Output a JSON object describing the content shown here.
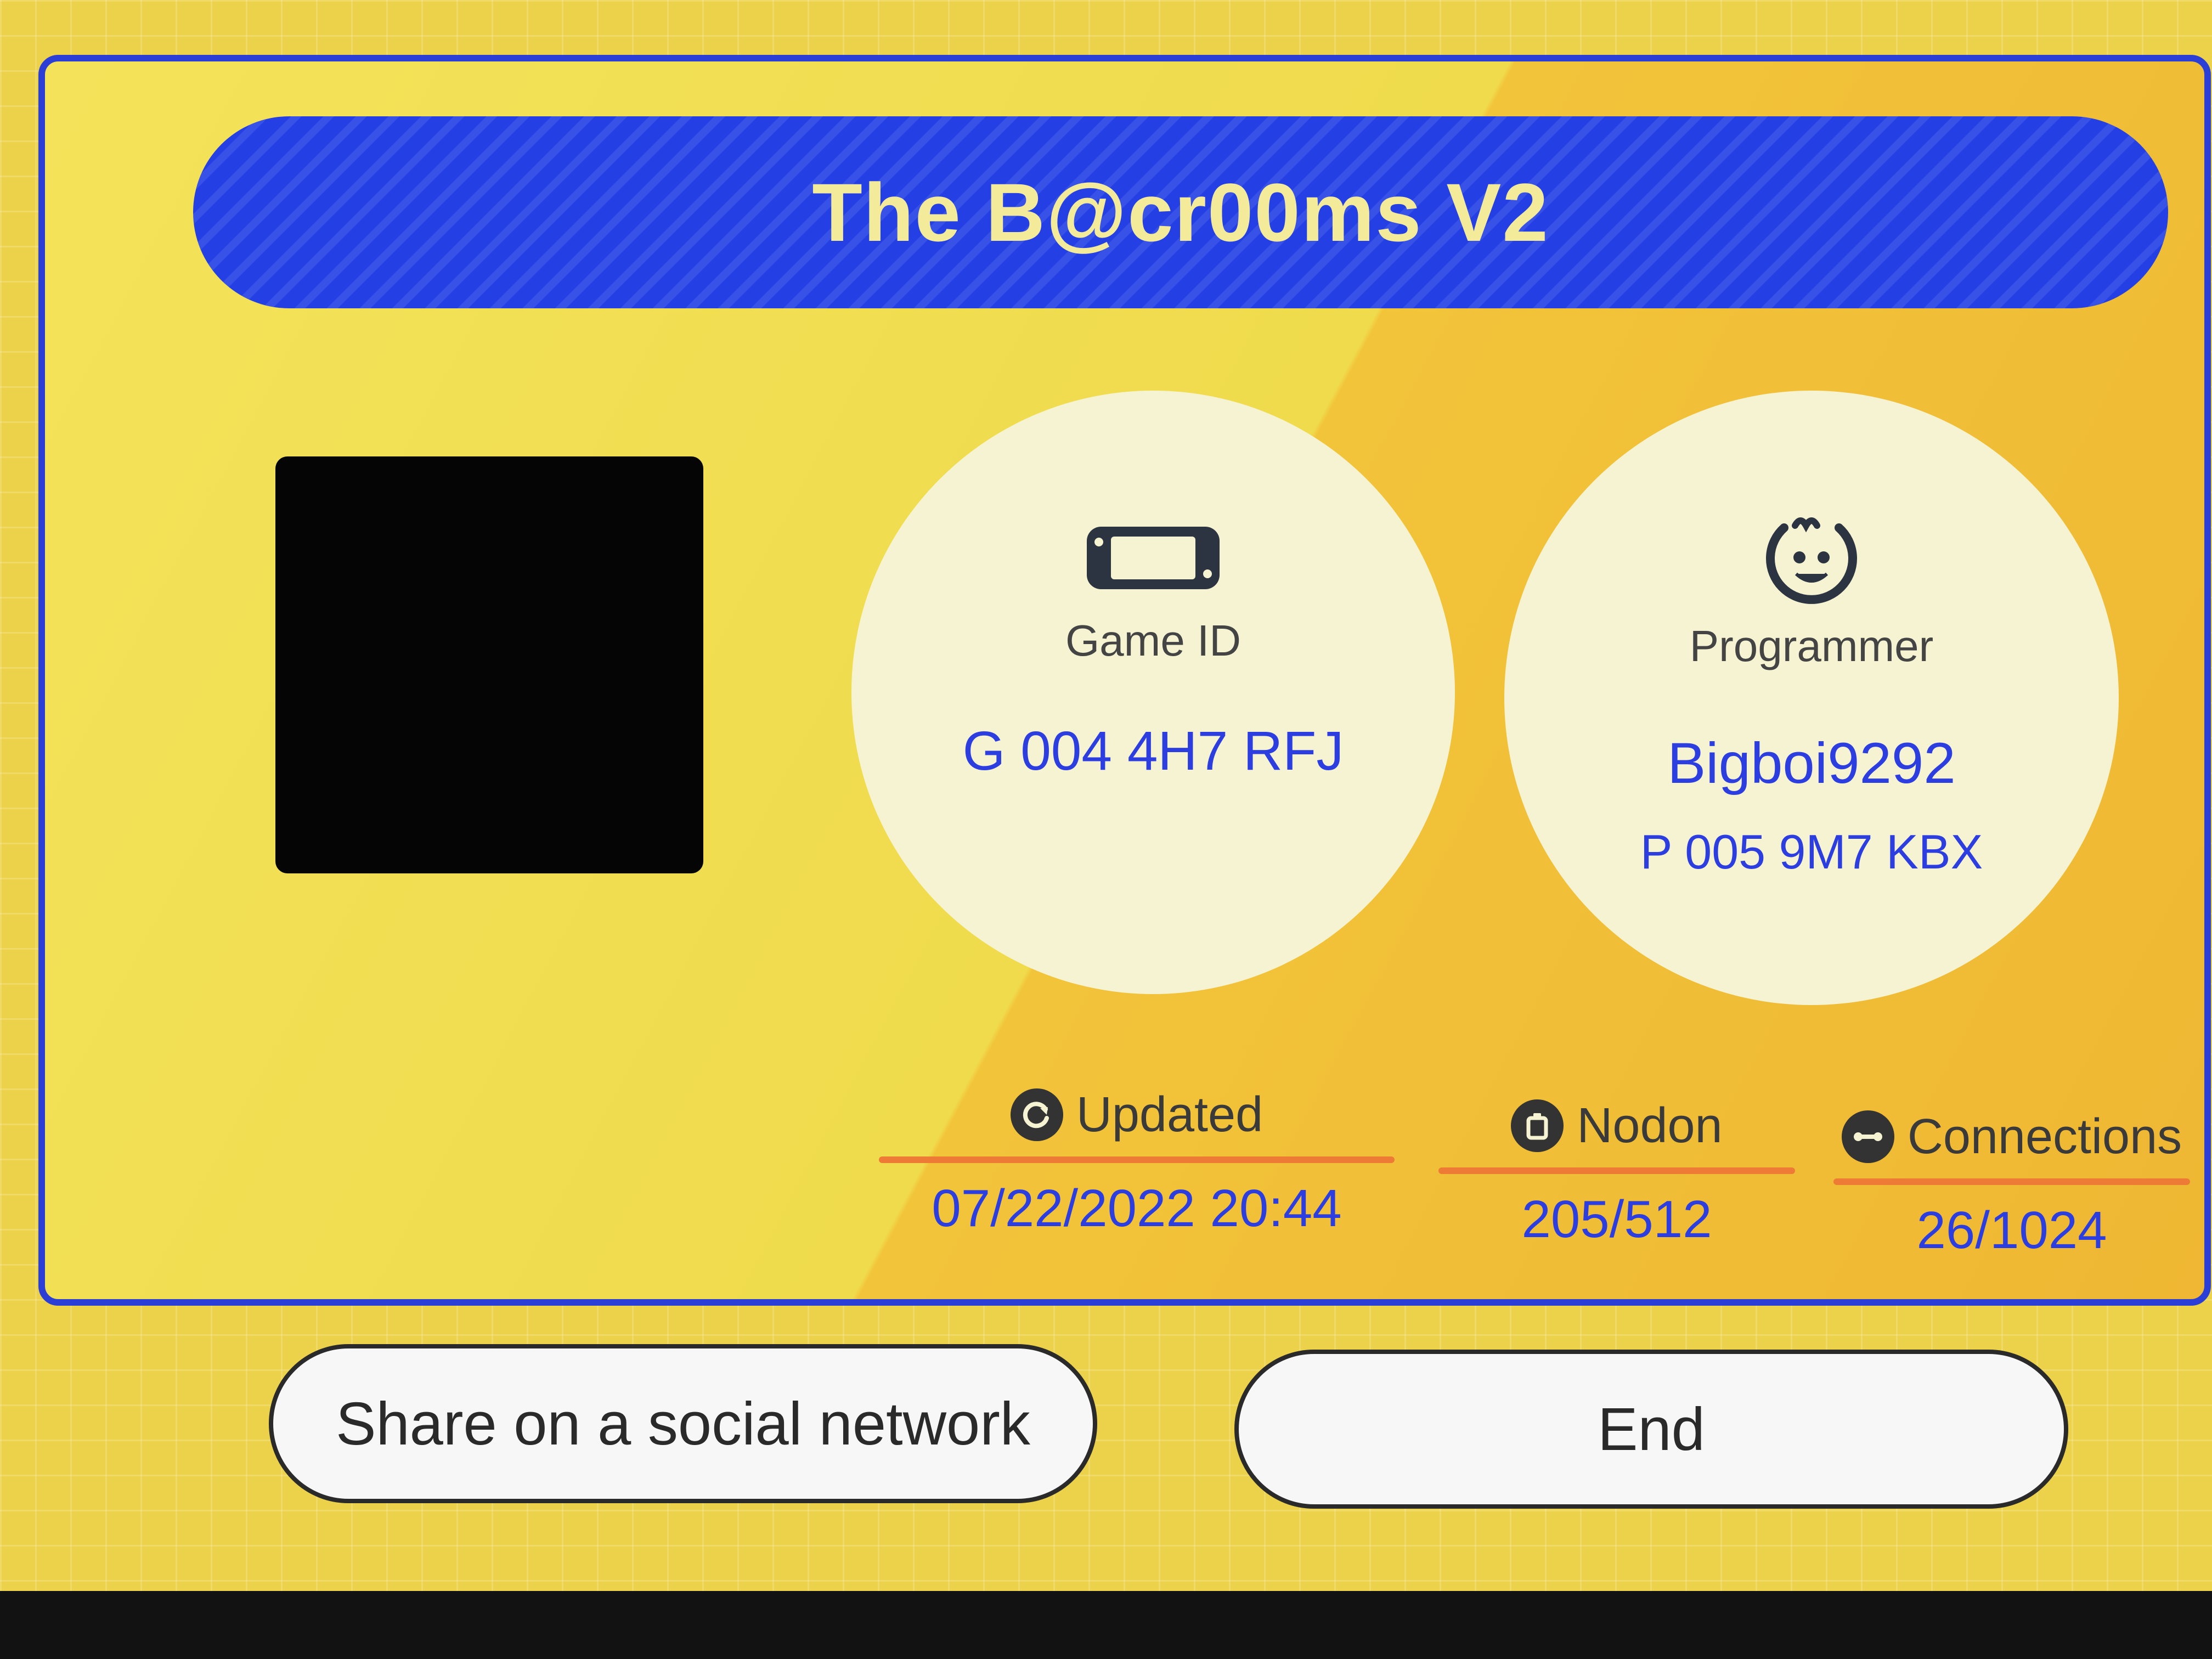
{
  "colors": {
    "background": "#ecd24a",
    "card_border": "#2b3fd6",
    "title_bar": "#2440e4",
    "title_text": "#f3eb9a",
    "value_text": "#2d3ee0",
    "underline": "#ee7b35",
    "circle_fill": "#f5f3d2"
  },
  "card": {
    "title": "The B@cr00ms V2",
    "thumbnail": "redacted-black-square"
  },
  "game": {
    "icon": "game-console-icon",
    "label": "Game ID",
    "value": "G 004 4H7 RFJ"
  },
  "programmer": {
    "icon": "smiley-face-icon",
    "label": "Programmer",
    "name": "Bigboi9292",
    "id": "P 005 9M7 KBX"
  },
  "stats": {
    "updated": {
      "icon": "refresh-icon",
      "label": "Updated",
      "value": "07/22/2022 20:44"
    },
    "nodon": {
      "icon": "nodon-icon",
      "label": "Nodon",
      "value": "205/512"
    },
    "connections": {
      "icon": "link-icon",
      "label": "Connections",
      "value": "26/1024"
    }
  },
  "buttons": {
    "share": "Share on a social network",
    "end": "End"
  }
}
